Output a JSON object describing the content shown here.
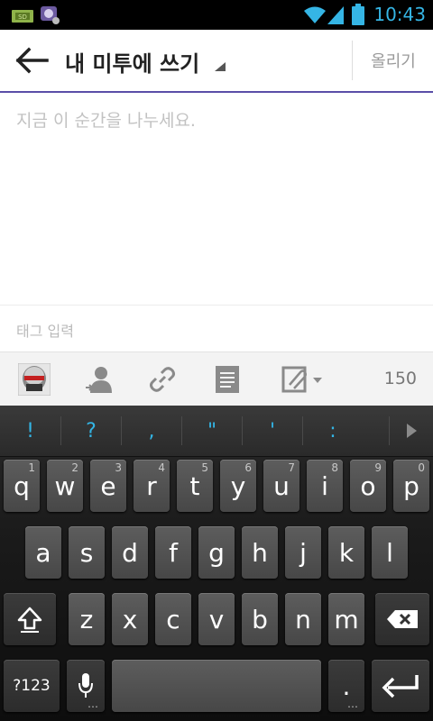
{
  "status_bar": {
    "time": "10:43",
    "icons": [
      "sd-card-icon",
      "media-icon",
      "wifi-icon",
      "signal-icon",
      "battery-icon"
    ]
  },
  "app_bar": {
    "title": "내 미투에 쓰기",
    "post_label": "올리기"
  },
  "compose": {
    "placeholder": "지금 이 순간을 나누세요.",
    "tag_placeholder": "태그 입력"
  },
  "toolbar": {
    "icons": [
      "avatar",
      "user-icon",
      "link-icon",
      "document-icon",
      "attach-icon"
    ],
    "char_count": "150"
  },
  "keyboard": {
    "suggestions": [
      "!",
      "?",
      ",",
      "\"",
      "'",
      ":"
    ],
    "row1": [
      {
        "k": "q",
        "n": "1"
      },
      {
        "k": "w",
        "n": "2"
      },
      {
        "k": "e",
        "n": "3"
      },
      {
        "k": "r",
        "n": "4"
      },
      {
        "k": "t",
        "n": "5"
      },
      {
        "k": "y",
        "n": "6"
      },
      {
        "k": "u",
        "n": "7"
      },
      {
        "k": "i",
        "n": "8"
      },
      {
        "k": "o",
        "n": "9"
      },
      {
        "k": "p",
        "n": "0"
      }
    ],
    "row2": [
      "a",
      "s",
      "d",
      "f",
      "g",
      "h",
      "j",
      "k",
      "l"
    ],
    "row3": [
      "z",
      "x",
      "c",
      "v",
      "b",
      "n",
      "m"
    ],
    "symbols_label": "?123",
    "period": "."
  },
  "colors": {
    "accent": "#5a4ea8",
    "status_blue": "#35b5e5",
    "suggestion": "#33b5e5"
  }
}
